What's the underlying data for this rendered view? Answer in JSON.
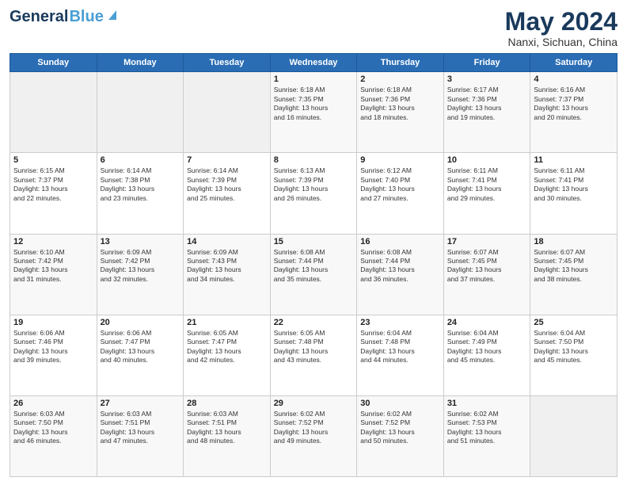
{
  "header": {
    "logo_general": "General",
    "logo_blue": "Blue",
    "title": "May 2024",
    "location": "Nanxi, Sichuan, China"
  },
  "days_of_week": [
    "Sunday",
    "Monday",
    "Tuesday",
    "Wednesday",
    "Thursday",
    "Friday",
    "Saturday"
  ],
  "weeks": [
    [
      {
        "day": "",
        "text": ""
      },
      {
        "day": "",
        "text": ""
      },
      {
        "day": "",
        "text": ""
      },
      {
        "day": "1",
        "text": "Sunrise: 6:18 AM\nSunset: 7:35 PM\nDaylight: 13 hours\nand 16 minutes."
      },
      {
        "day": "2",
        "text": "Sunrise: 6:18 AM\nSunset: 7:36 PM\nDaylight: 13 hours\nand 18 minutes."
      },
      {
        "day": "3",
        "text": "Sunrise: 6:17 AM\nSunset: 7:36 PM\nDaylight: 13 hours\nand 19 minutes."
      },
      {
        "day": "4",
        "text": "Sunrise: 6:16 AM\nSunset: 7:37 PM\nDaylight: 13 hours\nand 20 minutes."
      }
    ],
    [
      {
        "day": "5",
        "text": "Sunrise: 6:15 AM\nSunset: 7:37 PM\nDaylight: 13 hours\nand 22 minutes."
      },
      {
        "day": "6",
        "text": "Sunrise: 6:14 AM\nSunset: 7:38 PM\nDaylight: 13 hours\nand 23 minutes."
      },
      {
        "day": "7",
        "text": "Sunrise: 6:14 AM\nSunset: 7:39 PM\nDaylight: 13 hours\nand 25 minutes."
      },
      {
        "day": "8",
        "text": "Sunrise: 6:13 AM\nSunset: 7:39 PM\nDaylight: 13 hours\nand 26 minutes."
      },
      {
        "day": "9",
        "text": "Sunrise: 6:12 AM\nSunset: 7:40 PM\nDaylight: 13 hours\nand 27 minutes."
      },
      {
        "day": "10",
        "text": "Sunrise: 6:11 AM\nSunset: 7:41 PM\nDaylight: 13 hours\nand 29 minutes."
      },
      {
        "day": "11",
        "text": "Sunrise: 6:11 AM\nSunset: 7:41 PM\nDaylight: 13 hours\nand 30 minutes."
      }
    ],
    [
      {
        "day": "12",
        "text": "Sunrise: 6:10 AM\nSunset: 7:42 PM\nDaylight: 13 hours\nand 31 minutes."
      },
      {
        "day": "13",
        "text": "Sunrise: 6:09 AM\nSunset: 7:42 PM\nDaylight: 13 hours\nand 32 minutes."
      },
      {
        "day": "14",
        "text": "Sunrise: 6:09 AM\nSunset: 7:43 PM\nDaylight: 13 hours\nand 34 minutes."
      },
      {
        "day": "15",
        "text": "Sunrise: 6:08 AM\nSunset: 7:44 PM\nDaylight: 13 hours\nand 35 minutes."
      },
      {
        "day": "16",
        "text": "Sunrise: 6:08 AM\nSunset: 7:44 PM\nDaylight: 13 hours\nand 36 minutes."
      },
      {
        "day": "17",
        "text": "Sunrise: 6:07 AM\nSunset: 7:45 PM\nDaylight: 13 hours\nand 37 minutes."
      },
      {
        "day": "18",
        "text": "Sunrise: 6:07 AM\nSunset: 7:45 PM\nDaylight: 13 hours\nand 38 minutes."
      }
    ],
    [
      {
        "day": "19",
        "text": "Sunrise: 6:06 AM\nSunset: 7:46 PM\nDaylight: 13 hours\nand 39 minutes."
      },
      {
        "day": "20",
        "text": "Sunrise: 6:06 AM\nSunset: 7:47 PM\nDaylight: 13 hours\nand 40 minutes."
      },
      {
        "day": "21",
        "text": "Sunrise: 6:05 AM\nSunset: 7:47 PM\nDaylight: 13 hours\nand 42 minutes."
      },
      {
        "day": "22",
        "text": "Sunrise: 6:05 AM\nSunset: 7:48 PM\nDaylight: 13 hours\nand 43 minutes."
      },
      {
        "day": "23",
        "text": "Sunrise: 6:04 AM\nSunset: 7:48 PM\nDaylight: 13 hours\nand 44 minutes."
      },
      {
        "day": "24",
        "text": "Sunrise: 6:04 AM\nSunset: 7:49 PM\nDaylight: 13 hours\nand 45 minutes."
      },
      {
        "day": "25",
        "text": "Sunrise: 6:04 AM\nSunset: 7:50 PM\nDaylight: 13 hours\nand 45 minutes."
      }
    ],
    [
      {
        "day": "26",
        "text": "Sunrise: 6:03 AM\nSunset: 7:50 PM\nDaylight: 13 hours\nand 46 minutes."
      },
      {
        "day": "27",
        "text": "Sunrise: 6:03 AM\nSunset: 7:51 PM\nDaylight: 13 hours\nand 47 minutes."
      },
      {
        "day": "28",
        "text": "Sunrise: 6:03 AM\nSunset: 7:51 PM\nDaylight: 13 hours\nand 48 minutes."
      },
      {
        "day": "29",
        "text": "Sunrise: 6:02 AM\nSunset: 7:52 PM\nDaylight: 13 hours\nand 49 minutes."
      },
      {
        "day": "30",
        "text": "Sunrise: 6:02 AM\nSunset: 7:52 PM\nDaylight: 13 hours\nand 50 minutes."
      },
      {
        "day": "31",
        "text": "Sunrise: 6:02 AM\nSunset: 7:53 PM\nDaylight: 13 hours\nand 51 minutes."
      },
      {
        "day": "",
        "text": ""
      }
    ]
  ]
}
